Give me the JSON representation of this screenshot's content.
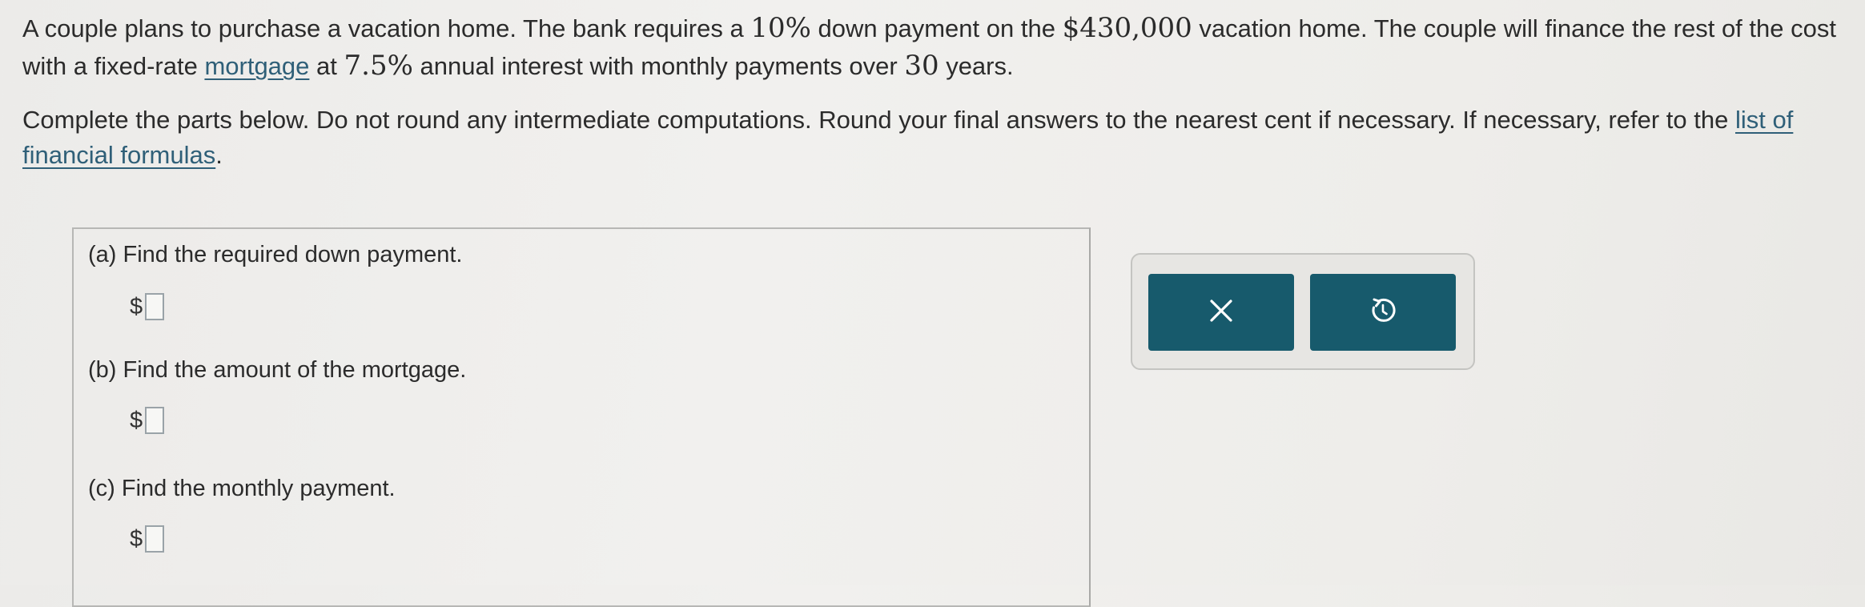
{
  "problem": {
    "p1_text1": "A couple plans to purchase a vacation home. The bank requires a ",
    "p1_down_pct": "10%",
    "p1_text2": " down payment on the ",
    "p1_price": "$430,000",
    "p1_text3": " vacation home. The couple will finance the rest of the cost with a fixed-rate ",
    "p1_mortgage_link": "mortgage",
    "p1_text4": " at ",
    "p1_rate": "7.5%",
    "p1_text5": " annual interest with monthly payments over ",
    "p1_years": "30",
    "p1_text6": " years.",
    "p2_text1": "Complete the parts below. Do not round any intermediate computations. Round your final answers to the nearest cent if necessary. If necessary, refer to the ",
    "p2_link": "list of financial formulas",
    "p2_text2": "."
  },
  "parts": [
    {
      "label": "(a) Find the required down payment.",
      "currency": "$",
      "value": ""
    },
    {
      "label": "(b) Find the amount of the mortgage.",
      "currency": "$",
      "value": ""
    },
    {
      "label": "(c) Find the monthly payment.",
      "currency": "$",
      "value": ""
    }
  ],
  "actions": {
    "clear_icon": "close-icon",
    "undo_icon": "undo-icon"
  },
  "colors": {
    "button": "#175a6c",
    "link": "#2f5f78"
  }
}
